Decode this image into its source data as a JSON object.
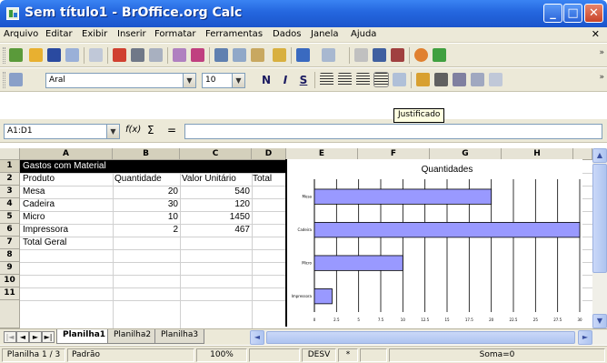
{
  "window": {
    "title": "Sem título1 - BrOffice.org Calc",
    "minimize_label": "_",
    "maximize_label": "□",
    "close_label": "✕"
  },
  "menu": {
    "items": [
      "Arquivo",
      "Editar",
      "Exibir",
      "Inserir",
      "Formatar",
      "Ferramentas",
      "Dados",
      "Janela",
      "Ajuda"
    ],
    "close_label": "✕"
  },
  "toolbar_more": "»",
  "format_toolbar": {
    "font_name": "Aral",
    "font_size": "10",
    "bold": "N",
    "italic": "I",
    "underline": "S",
    "tooltip": "Justificado"
  },
  "formula_bar": {
    "cell_ref": "A1:D1",
    "fx_label": "f(x)",
    "sigma_label": "Σ",
    "equals_label": "=",
    "formula": ""
  },
  "columns": [
    "A",
    "B",
    "C",
    "D",
    "E",
    "F",
    "G",
    "H"
  ],
  "rows": [
    "1",
    "2",
    "3",
    "4",
    "5",
    "6",
    "7",
    "8",
    "9",
    "10",
    "11"
  ],
  "cells": {
    "title": "Gastos com Material",
    "header": [
      "Produto",
      "Quantidade",
      "Valor Unitário",
      "Total"
    ],
    "data": [
      [
        "Mesa",
        "20",
        "540"
      ],
      [
        "Cadeira",
        "30",
        "120"
      ],
      [
        "Micro",
        "10",
        "1450"
      ],
      [
        "Impressora",
        "2",
        "467"
      ]
    ],
    "total_label": "Total Geral"
  },
  "chart_data": {
    "type": "bar",
    "orientation": "horizontal",
    "title": "Quantidades",
    "categories": [
      "Mesa",
      "Cadeira",
      "Micro",
      "Impressora"
    ],
    "values": [
      20,
      30,
      10,
      2
    ],
    "xlim": [
      0,
      30
    ],
    "x_ticks": [
      "0",
      "2.5",
      "5",
      "7.5",
      "10",
      "12.5",
      "15",
      "17.5",
      "20",
      "22.5",
      "25",
      "27.5",
      "30"
    ],
    "bar_color": "#9999ff",
    "grid": true
  },
  "sheets": {
    "nav": [
      "◄",
      "►",
      "►|"
    ],
    "tabs": [
      "Planilha1",
      "Planilha2",
      "Planilha3"
    ],
    "active": "Planilha1"
  },
  "status": {
    "sheet": "Planilha 1 / 3",
    "style": "Padrão",
    "zoom": "100%",
    "mode": "DESV",
    "modified": "*",
    "sum": "Soma=0"
  }
}
